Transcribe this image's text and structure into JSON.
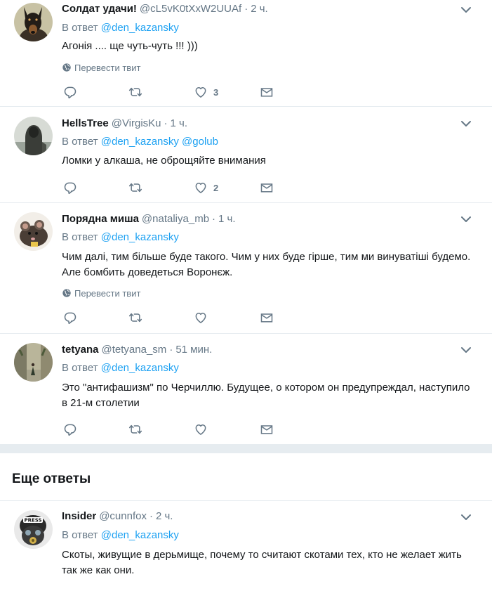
{
  "common": {
    "reply_prefix": "В ответ",
    "translate_label": "Перевести твит",
    "dot": "·"
  },
  "tweets": [
    {
      "name": "Солдат удачи!",
      "handle": "@cL5vK0tXxW2UUAf",
      "time": "2 ч.",
      "mentions": [
        "@den_kazansky"
      ],
      "text": "Агонія .... ще чуть-чуть !!! )))",
      "likes": "3",
      "avatar": "doberman-avatar"
    },
    {
      "name": "HellsTree",
      "handle": "@VirgisKu",
      "time": "1 ч.",
      "mentions": [
        "@den_kazansky",
        "@golub"
      ],
      "text": "Ломки у алкаша, не оброщяйте внимания",
      "likes": "2",
      "avatar": "hooded-figure-avatar"
    },
    {
      "name": "Порядна миша",
      "handle": "@nataliya_mb",
      "time": "1 ч.",
      "mentions": [
        "@den_kazansky"
      ],
      "text": "Чим далі, тим більше буде такого. Чим у них буде гірше, тим ми винуватіші будемо. Але бомбить доведеться Воронєж.",
      "likes": "",
      "avatar": "rat-avatar"
    },
    {
      "name": "tetyana",
      "handle": "@tetyana_sm",
      "time": "51 мин.",
      "mentions": [
        "@den_kazansky"
      ],
      "text": "Это \"антифашизм\" по Черчиллю. Будущее, о котором он предупреждал, наступило в 21-м столетии",
      "likes": "",
      "avatar": "street-photo-avatar"
    }
  ],
  "more_replies_title": "Еще ответы",
  "more_tweets": [
    {
      "name": "Insider",
      "handle": "@cunnfox",
      "time": "2 ч.",
      "mentions": [
        "@den_kazansky"
      ],
      "text": "Скоты, живущие в дерьмище, почему то считают скотами тех, кто не желает жить так же как они.",
      "avatar": "gas-mask-press-avatar"
    }
  ],
  "colors": {
    "link": "#1da1f2",
    "secondary": "#657786",
    "divider": "#e6ecf0",
    "text": "#14171a"
  }
}
